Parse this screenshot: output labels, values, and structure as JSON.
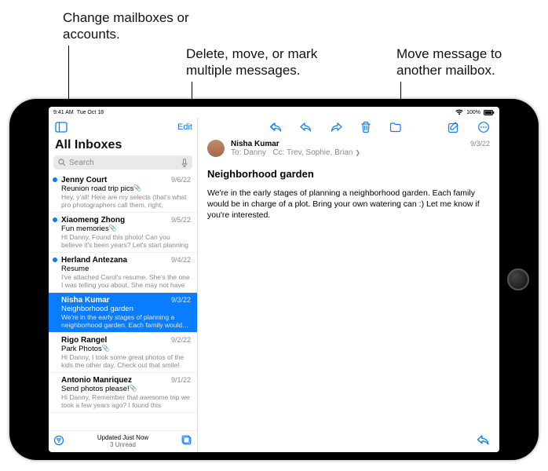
{
  "annotations": {
    "mailboxes": "Change mailboxes or accounts.",
    "edit": "Delete, move, or mark multiple messages.",
    "move": "Move message to another mailbox."
  },
  "status": {
    "time": "9:41 AM",
    "date": "Tue Oct 18",
    "wifi": "wifi-icon",
    "battery_pct": "100%"
  },
  "list": {
    "edit_label": "Edit",
    "title": "All Inboxes",
    "search_placeholder": "Search",
    "footer_updated": "Updated Just Now",
    "footer_unread": "3 Unread",
    "rows": [
      {
        "from": "Jenny Court",
        "date": "9/6/22",
        "unread": true,
        "attach": true,
        "subject": "Reunion road trip pics",
        "preview": "Hey, y'all! Here are my selects (that's what pro photographers call them, right, Andre?…"
      },
      {
        "from": "Xiaomeng Zhong",
        "date": "9/5/22",
        "unread": true,
        "attach": true,
        "subject": "Fun memories",
        "preview": "Hi Danny, Found this photo! Can you believe it's been years? Let's start planning our ne…"
      },
      {
        "from": "Herland Antezana",
        "date": "9/4/22",
        "unread": true,
        "attach": false,
        "subject": "Resume",
        "preview": "I've attached Carol's resume. She's the one I was telling you about. She may not have qu…"
      },
      {
        "from": "Nisha Kumar",
        "date": "9/3/22",
        "unread": false,
        "attach": false,
        "selected": true,
        "subject": "Neighborhood garden",
        "preview": "We're in the early stages of planning a neighborhood garden. Each family would…"
      },
      {
        "from": "Rigo Rangel",
        "date": "9/2/22",
        "unread": false,
        "attach": true,
        "subject": "Park Photos",
        "preview": "Hi Danny, I took some great photos of the kids the other day. Check out that smile!"
      },
      {
        "from": "Antonio Manriquez",
        "date": "9/1/22",
        "unread": false,
        "attach": true,
        "subject": "Send photos please!",
        "preview": "Hi Danny, Remember that awesome trip we took a few years ago? I found this picture,…"
      }
    ]
  },
  "message": {
    "from": "Nisha Kumar",
    "to_label": "To:",
    "to": "Danny",
    "cc_label": "Cc:",
    "cc": "Trev, Sophie, Brian",
    "date": "9/3/22",
    "subject": "Neighborhood garden",
    "body": "We're in the early stages of planning a neighborhood garden. Each family would be in charge of a plot. Bring your own watering can :) Let me know if you're interested."
  },
  "icons": {
    "sidebar": "sidebar-icon",
    "reply_all": "reply-all-icon",
    "reply": "reply-icon",
    "forward": "forward-icon",
    "trash": "trash-icon",
    "folder": "folder-icon",
    "compose": "compose-icon",
    "more": "more-icon",
    "filter": "filter-icon",
    "new_mailbox": "new-mailbox-icon",
    "mic": "mic-icon"
  }
}
